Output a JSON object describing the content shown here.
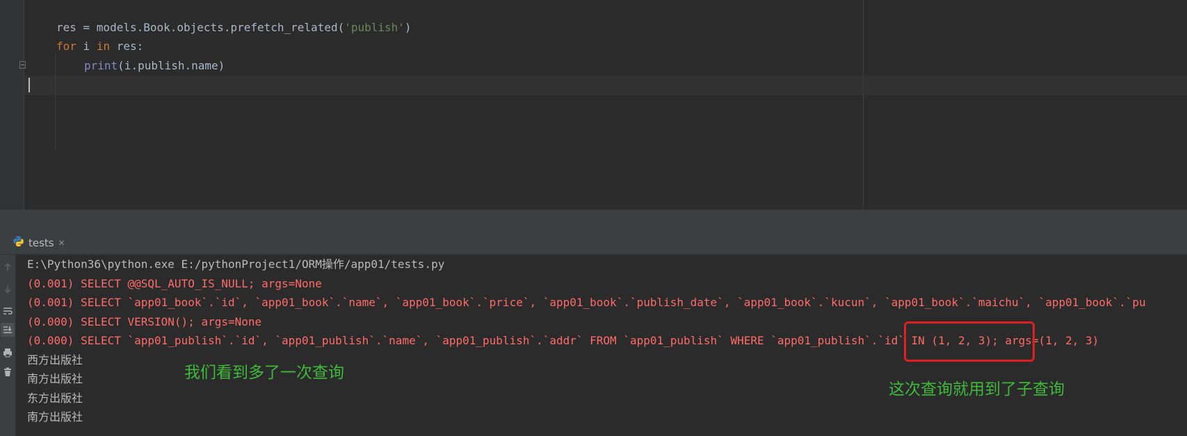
{
  "editor": {
    "code": {
      "line1": {
        "pre": "res = models.Book.objects.prefetch_related(",
        "str": "'publish'",
        "post": ")"
      },
      "line2": {
        "kw1": "for",
        "mid1": " i ",
        "kw2": "in",
        "post": " res:"
      },
      "line3": {
        "builtin": "print",
        "post": "(i.publish.name)"
      }
    }
  },
  "run_panel": {
    "tab_label": "tests",
    "tab_close": "✕",
    "console": {
      "command": "E:\\Python36\\python.exe E:/pythonProject1/ORM操作/app01/tests.py",
      "sql_lines": [
        "(0.001) SELECT @@SQL_AUTO_IS_NULL; args=None",
        "(0.001) SELECT `app01_book`.`id`, `app01_book`.`name`, `app01_book`.`price`, `app01_book`.`publish_date`, `app01_book`.`kucun`, `app01_book`.`maichu`, `app01_book`.`pu",
        "(0.000) SELECT VERSION(); args=None",
        "(0.000) SELECT `app01_publish`.`id`, `app01_publish`.`name`, `app01_publish`.`addr` FROM `app01_publish` WHERE `app01_publish`.`id` IN (1, 2, 3); args=(1, 2, 3)"
      ],
      "outputs": [
        "西方出版社",
        "南方出版社",
        "东方出版社",
        "南方出版社"
      ]
    }
  },
  "annotations": {
    "left": "我们看到多了一次查询",
    "right": "这次查询就用到了子查询"
  },
  "colors": {
    "annotation": "#3fb93a",
    "highlight_box": "#e02020",
    "sql_text": "#ff6b68",
    "keyword": "#cc7832",
    "string": "#6a8759"
  },
  "icons": [
    "python-icon",
    "scroll-up-icon",
    "scroll-down-icon",
    "soft-wrap-icon",
    "scroll-to-end-icon",
    "print-icon",
    "trash-icon"
  ]
}
